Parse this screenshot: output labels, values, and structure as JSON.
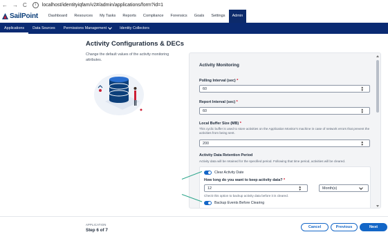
{
  "browser": {
    "back": "←",
    "forward": "→",
    "reload": "C",
    "info": "i",
    "url": "localhost/identityiqfam/v2#/admin/applications/form?id=1"
  },
  "header": {
    "logo_text": "SailPoint",
    "brand_color": "#0c3f7a",
    "nav": [
      "Dashboard",
      "Resources",
      "My Tasks",
      "Reports",
      "Compliance",
      "Forensics",
      "Goals",
      "Settings",
      "Admin"
    ],
    "active_nav": "Admin"
  },
  "subnav": {
    "items": [
      "Applications",
      "Data Sources",
      "Permissions Management",
      "Identity Collectors"
    ],
    "active": "Applications"
  },
  "page": {
    "title": "Activity Configurations & DECs",
    "description": "Change the default values of the activity monitoring attributes."
  },
  "panel": {
    "section_title": "Activity Monitoring",
    "polling": {
      "label": "Polling Interval (sec)",
      "required": "*",
      "value": "60"
    },
    "report": {
      "label": "Report Interval (sec)",
      "required": "*",
      "value": "60"
    },
    "buffer": {
      "label": "Local Buffer Size (MB)",
      "required": "*",
      "help": "This cyclic buffer is used to store activities on the Application Monitor's machine in case of network errors that prevent the activities from being sent.",
      "value": "200"
    },
    "retention": {
      "title": "Activity Data Retention Period",
      "help": "Activity data will be retained for the specified period. Following that time period, activities will be cleared.",
      "clear_toggle_label": "Clear Activity Date",
      "clear_toggle_on": true,
      "keep_label": "How long do you want to keep activity data?",
      "required": "*",
      "keep_value": "12",
      "keep_unit": "Month(s)",
      "backup_help": "Check this option to backup activity data before it is cleared.",
      "backup_toggle_label": "Backup Events Before Clearing",
      "backup_toggle_on": true
    }
  },
  "footer": {
    "context": "APPLICATION",
    "step": "Step 6 of 7",
    "cancel": "Cancel",
    "previous": "Previous",
    "next": "Next",
    "accent": "#1366c7"
  }
}
